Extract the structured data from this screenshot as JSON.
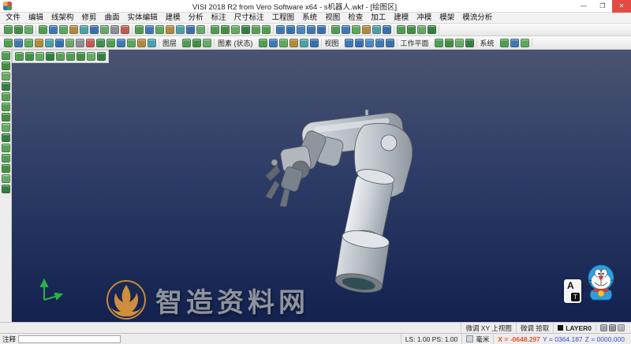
{
  "window": {
    "title": "VISI 2018 R2 from Vero Software x64 - s机器人.wkf - [绘图区]",
    "minimize": "—",
    "maximize": "❐",
    "close": "✕"
  },
  "menu": {
    "items": [
      "文件",
      "编辑",
      "线架构",
      "修剪",
      "曲面",
      "实体编辑",
      "建模",
      "分析",
      "标注",
      "尺寸标注",
      "工程图",
      "系统",
      "视图",
      "检查",
      "加工",
      "建模",
      "冲模",
      "模架",
      "模流分析"
    ]
  },
  "palettes": {
    "mixed": [
      "#4d9e50",
      "#3c78b4",
      "#5aa85a",
      "#b08a3c",
      "#4aa0a8",
      "#356fae",
      "#69a869",
      "#8a8f96",
      "#c25a50",
      "#3f8f4f"
    ],
    "green": [
      "#4d9e50",
      "#3f8f3f",
      "#63aa63",
      "#2f7f3f",
      "#55a055"
    ],
    "blue": [
      "#3c78b4",
      "#356fae",
      "#4a86c0"
    ],
    "gray": [
      "#9aa0a6",
      "#8a9096",
      "#b0b5ba"
    ]
  },
  "toolbar1": {
    "groups": [
      {
        "count": 3,
        "palette": "green"
      },
      {
        "count": 9,
        "palette": "mixed"
      },
      {
        "count": 7,
        "palette": "mixed"
      },
      {
        "count": 6,
        "palette": "green"
      },
      {
        "count": 5,
        "palette": "blue"
      },
      {
        "count": 6,
        "palette": "mixed"
      },
      {
        "count": 4,
        "palette": "green"
      }
    ]
  },
  "toolbar2": {
    "groups": [
      {
        "count": 15,
        "palette": "mixed"
      },
      {
        "label": "图层"
      },
      {
        "count": 3,
        "palette": "green"
      },
      {
        "label": "图素 (状态)"
      },
      {
        "count": 6,
        "palette": "mixed"
      },
      {
        "label": "视图"
      },
      {
        "count": 5,
        "palette": "blue"
      },
      {
        "label": "工作平面"
      },
      {
        "count": 4,
        "palette": "green"
      },
      {
        "label": "系统"
      },
      {
        "count": 3,
        "palette": "mixed"
      }
    ]
  },
  "rail": {
    "count": 14,
    "palette": "green"
  },
  "float_toolbar": {
    "count": 9,
    "palette": "green"
  },
  "viewport": {
    "watermark": "智造资料网",
    "sticker": {
      "a": "A",
      "t": "T"
    }
  },
  "statusbar": {
    "hint_view": "微调 XY 上视图",
    "hint_pick": "微调 拾取",
    "layer": "LAYER0",
    "icons": {
      "count": 3,
      "palette": "gray"
    },
    "note_label": "注释",
    "scale": "LS: 1.00 PS: 1.00",
    "unit": "毫米",
    "coord_x": "X = -0648.297",
    "coord_y": "Y = 0364.187",
    "coord_z": "Z = 0000.000"
  },
  "colors": {
    "viewport_top": "#4a5470",
    "viewport_bottom": "#13214e",
    "coord_x_color": "#e0542a",
    "coord_yz_color": "#3a52c8",
    "watermark_gold": "#e29a3b",
    "watermark_gray": "#8d939c",
    "close_button": "#e24a42"
  }
}
